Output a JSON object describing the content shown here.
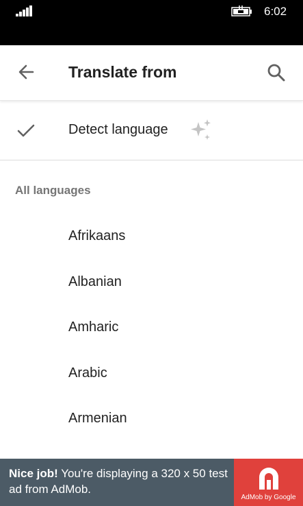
{
  "status_bar": {
    "time": "6:02"
  },
  "toolbar": {
    "title": "Translate from"
  },
  "detect": {
    "label": "Detect language"
  },
  "section": {
    "header": "All languages"
  },
  "languages": [
    "Afrikaans",
    "Albanian",
    "Amharic",
    "Arabic",
    "Armenian"
  ],
  "ad": {
    "headline": "Nice job!",
    "body": "You're displaying a 320 x 50 test ad from AdMob.",
    "brand": "AdMob by Google"
  },
  "colors": {
    "status_bar_bg": "#000000",
    "ad_bg": "#4c5b66",
    "ad_logo_bg": "#e0413c",
    "section_header": "#757575"
  },
  "icons": [
    "signal-icon",
    "battery-icon",
    "back-arrow-icon",
    "search-icon",
    "checkmark-icon",
    "sparkle-icon",
    "admob-logo-icon"
  ]
}
